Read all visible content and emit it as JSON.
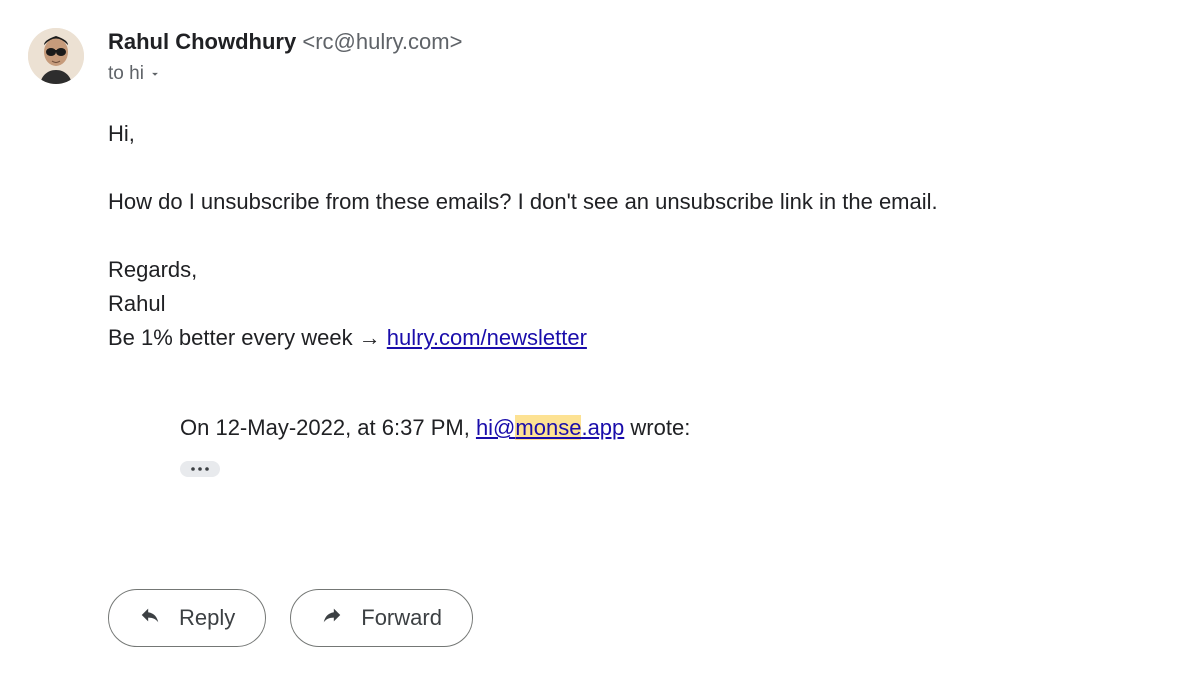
{
  "sender": {
    "name": "Rahul Chowdhury",
    "email_bracketed": "<rc@hulry.com>",
    "to_line": "to hi"
  },
  "body": {
    "greeting": "Hi,",
    "para1": "How do I unsubscribe from these emails? I don't see an unsubscribe link in the email.",
    "regards": "Regards,",
    "sig_name": "Rahul",
    "sig_prefix": "Be 1% better every week → ",
    "sig_link_text": "hulry.com/newsletter"
  },
  "quoted": {
    "prefix": "On 12-May-2022, at 6:37 PM, ",
    "email_part1": "hi@",
    "email_part2": "monse",
    "email_part3": ".app",
    "suffix": " wrote:"
  },
  "actions": {
    "reply_label": "Reply",
    "forward_label": "Forward"
  }
}
